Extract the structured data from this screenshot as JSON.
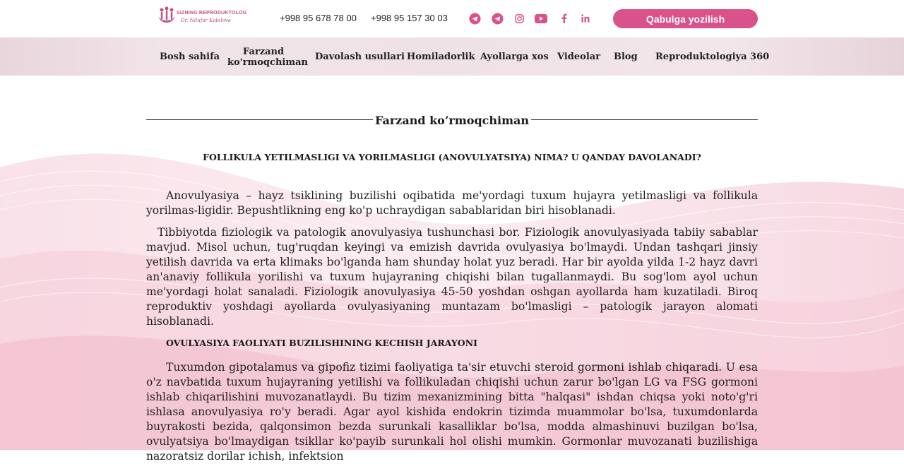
{
  "logo": {
    "line1": "SIZNING REPRODUKTOLOG",
    "line2": "Dr. Nilufar Kabilova"
  },
  "header": {
    "phone1": "+998 95 678 78 00",
    "phone2": "+998 95 157 30 03",
    "cta_label": "Qabulga yozilish",
    "accent_color": "#d9528b",
    "socials": [
      "telegram-icon",
      "telegram-icon",
      "instagram-icon",
      "youtube-icon",
      "facebook-icon",
      "linkedin-icon"
    ]
  },
  "nav": {
    "items": [
      "Bosh sahifa",
      "Farzand ko'rmoqchiman",
      "Davolash usullari",
      "Homiladorlik",
      "Ayollarga xos",
      "Videolar",
      "Blog",
      "Reproduktologiya 360"
    ]
  },
  "main": {
    "section_title": "Farzand ko’rmoqchiman",
    "heading1": "FOLLIKULA YETILMASLIGI VA YORILMASLIGI (ANOVULYATSIYA) NIMA? U QANDAY DAVOLANADI?",
    "para1": "Anovulyasiya – hayz tsiklining buzilishi oqibatida me'yordagi tuxum hujayra yetilmasligi va follikula yorilmas-ligidir. Bepushtlikning eng ko'p uchraydigan sabablaridan biri hisoblanadi.",
    "para2": "Tibbiyotda fiziologik va patologik anovulyasiya tushunchasi bor. Fiziologik anovulyasiyada tabiiy sabablar mavjud. Misol uchun, tug'ruqdan keyingi va emizish davrida ovulyasiya bo'lmaydi. Undan tashqari jinsiy yetilish davrida va erta klimaks bo'lganda ham shunday holat yuz beradi. Har bir ayolda yilda 1-2 hayz davri an'anaviy follikula yorilishi va tuxum hujayraning chiqishi bilan tugallanmaydi. Bu sog'lom ayol uchun me'yordagi holat sanaladi. Fiziologik anovulyasiya 45-50 yoshdan oshgan ayollarda ham kuzatiladi. Biroq reproduktiv yoshdagi ayollarda ovulyasiyaning muntazam bo'lmasligi – patologik jarayon alomati hisoblanadi.",
    "heading2": "OVULYASIYA FAOLIYATI BUZILISHINING KECHISH JARAYONI",
    "para3": "Tuxumdon gipotalamus va gipofiz tizimi faoliyatiga ta'sir etuvchi steroid gormoni ishlab chiqaradi. U esa o'z navbatida tuxum hujayraning yetilishi va follikuladan chiqishi uchun zarur bo'lgan LG va FSG gormoni ishlab chiqarilishini muvozanatlaydi. Bu tizim mexanizmining bitta \"halqasi\" ishdan chiqsa yoki noto'g'ri ishlasa anovulyasiya ro'y beradi. Agar ayol kishida endokrin tizimda muammolar bo'lsa, tuxumdonlarda buyrakosti bezida, qalqonsimon bezda surunkali kasalliklar bo'lsa, modda almashinuvi buzilgan bo'lsa, ovulyatsiya bo'lmaydigan tsikllar ko'payib surunkali hol olishi mumkin. Gormonlar muvozanati buzilishiga nazoratsiz dorilar ichish, infektsion"
  }
}
